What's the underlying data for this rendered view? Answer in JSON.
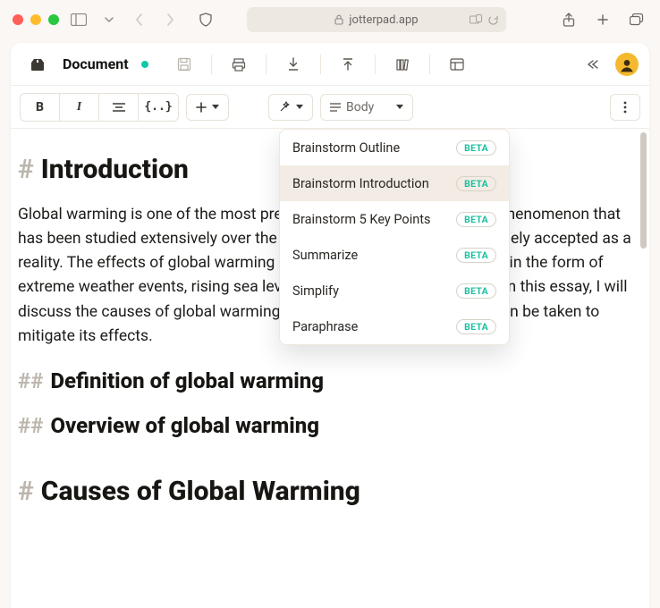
{
  "browser": {
    "url": "jotterpad.app"
  },
  "app": {
    "doc_title": "Document",
    "style_label": "Body"
  },
  "dropdown": {
    "items": [
      {
        "label": "Brainstorm Outline",
        "badge": "BETA",
        "selected": false
      },
      {
        "label": "Brainstorm Introduction",
        "badge": "BETA",
        "selected": true
      },
      {
        "label": "Brainstorm 5 Key Points",
        "badge": "BETA",
        "selected": false
      },
      {
        "label": "Summarize",
        "badge": "BETA",
        "selected": false
      },
      {
        "label": "Simplify",
        "badge": "BETA",
        "selected": false
      },
      {
        "label": "Paraphrase",
        "badge": "BETA",
        "selected": false
      }
    ]
  },
  "doc": {
    "h1_mark": "#",
    "h1": "Introduction",
    "p1": "Global warming is one of the most pressing issues of our time. It is a phenomenon that has been studied extensively over the past few decades and is now widely accepted as a reality. The effects of global warming are far-reaching and can be seen in the form of extreme weather events, rising sea levels, and changes in the climate. In this essay, I will discuss the causes of global warming, its effects, and the steps that can be taken to mitigate its effects.",
    "h2a_mark": "##",
    "h2a": "Definition of global warming",
    "h2b_mark": "##",
    "h2b": "Overview of global warming",
    "h1b_mark": "#",
    "h1b": "Causes of Global Warming"
  }
}
